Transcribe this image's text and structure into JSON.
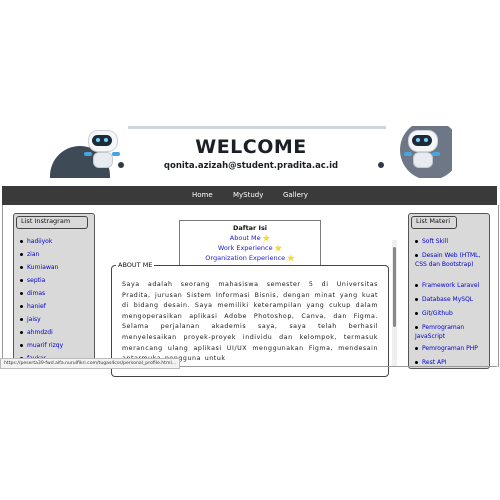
{
  "banner": {
    "title": "WELCOME",
    "email": "qonita.azizah@student.pradita.ac.id"
  },
  "nav": {
    "items": [
      {
        "label": "Home"
      },
      {
        "label": "MyStudy"
      },
      {
        "label": "Gallery"
      }
    ]
  },
  "left_panel": {
    "title": "List Instragram",
    "items": [
      "hadiiyok",
      "zian",
      "Kurniawan",
      "septia",
      "dimas",
      "hanief",
      "jaisy",
      "ahmdzdi",
      "muarif rizqy",
      "faykar"
    ]
  },
  "toc": {
    "title": "Daftar Isi",
    "items": [
      {
        "label": "About Me",
        "star": "⭐"
      },
      {
        "label": "Work Experience",
        "star": "⭐"
      },
      {
        "label": "Organization Experience",
        "star": "⭐"
      }
    ]
  },
  "about": {
    "label": "ABOUT ME",
    "text": "Saya adalah seorang mahasiswa semester 5 di Universitas Pradita, jurusan Sistem Informasi Bisnis, dengan minat yang kuat di bidang desain. Saya memiliki keterampilan yang cukup dalam mengoperasikan aplikasi Adobe Photoshop, Canva, dan Figma. Selama perjalanan akademis saya, saya telah berhasil menyelesaikan proyek-proyek individu dan kelompok, termasuk merancang ulang aplikasi UI/UX menggunakan Figma, mendesain antarmuka pengguna untuk"
  },
  "right_panel": {
    "title": "List Materi",
    "items": [
      "Soft Skill",
      "Desain Web (HTML, CSS dan Bootstrap)",
      "Framework Laravel",
      "Database MySQL",
      "Git/Github",
      "Pemrograman JavaScript",
      "Pemrograman PHP",
      "Rest API"
    ]
  },
  "status_bar": {
    "url": "https://peserta39-fwd.alfa.nurulfikri.com/tugas4css/personal_profile.html..."
  },
  "colors": {
    "navbar": "#3a3a3a",
    "panel_bg": "#d9d9d9",
    "link": "#0000cc",
    "star": "#f2b300"
  }
}
